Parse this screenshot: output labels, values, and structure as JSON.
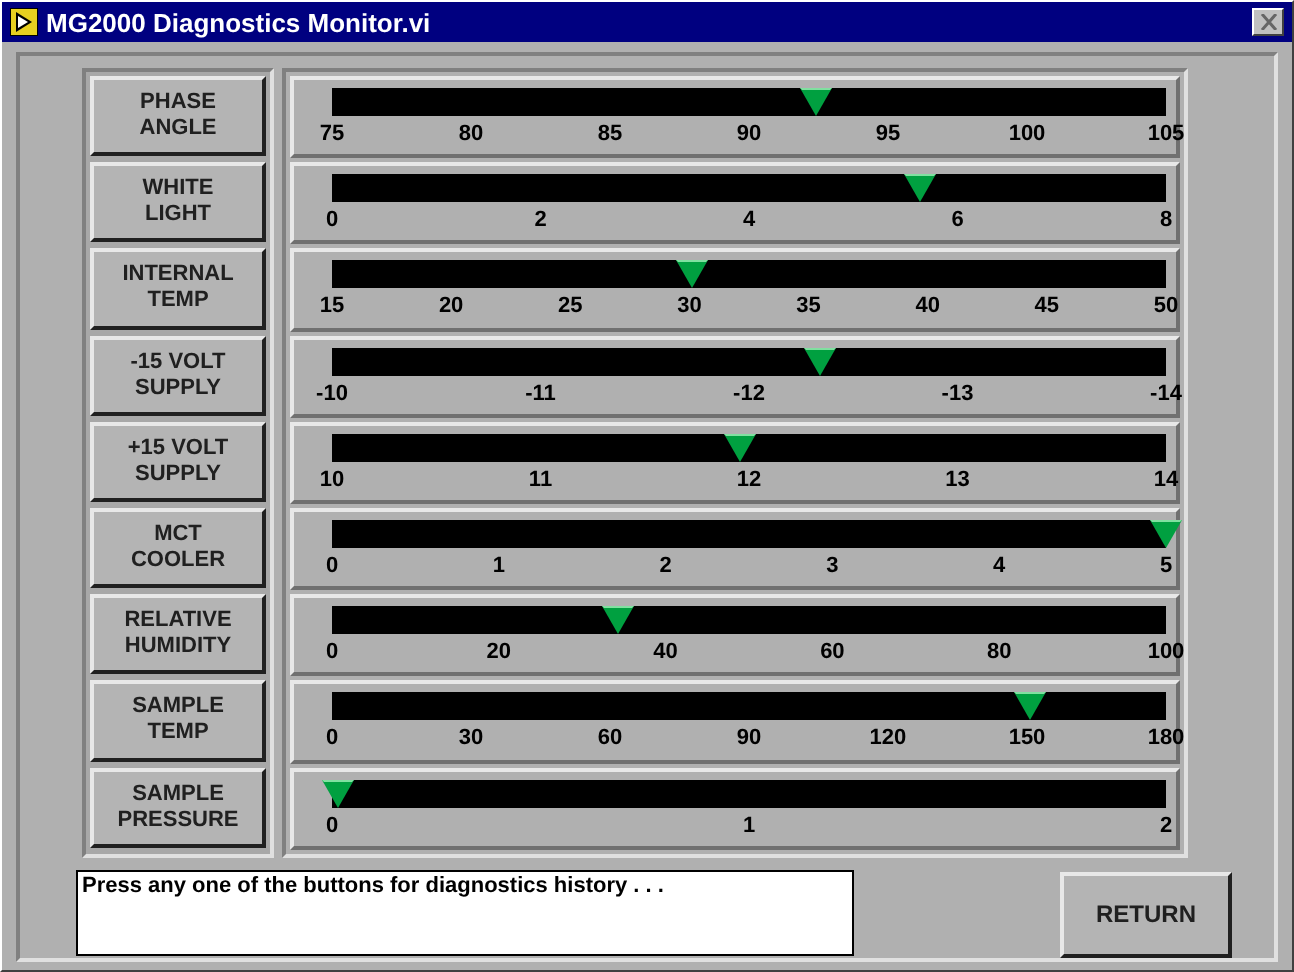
{
  "window": {
    "title": "MG2000 Diagnostics Monitor.vi"
  },
  "monitors": [
    {
      "button": "PHASE\nANGLE",
      "level": 0.581,
      "ticks": [
        "75",
        "80",
        "85",
        "90",
        "95",
        "100",
        "105"
      ]
    },
    {
      "button": "WHITE\nLIGHT",
      "level": 0.704,
      "ticks": [
        "0",
        "2",
        "4",
        "6",
        "8"
      ]
    },
    {
      "button": "INTERNAL\nTEMP",
      "level": 0.431,
      "ticks": [
        "15",
        "20",
        "25",
        "30",
        "35",
        "40",
        "45",
        "50"
      ]
    },
    {
      "button": "-15 VOLT\nSUPPLY",
      "level": 0.586,
      "ticks": [
        "-10",
        "-11",
        "-12",
        "-13",
        "-14"
      ]
    },
    {
      "button": "+15 VOLT\nSUPPLY",
      "level": 0.489,
      "ticks": [
        "10",
        "11",
        "12",
        "13",
        "14"
      ]
    },
    {
      "button": "MCT\nCOOLER",
      "level": 1.0,
      "ticks": [
        "0",
        "1",
        "2",
        "3",
        "4",
        "5"
      ]
    },
    {
      "button": "RELATIVE\nHUMIDITY",
      "level": 0.344,
      "ticks": [
        "0",
        "20",
        "40",
        "60",
        "80",
        "100"
      ]
    },
    {
      "button": "SAMPLE\nTEMP",
      "level": 0.838,
      "ticks": [
        "0",
        "30",
        "60",
        "90",
        "120",
        "150",
        "180"
      ]
    },
    {
      "button": "SAMPLE\nPRESSURE",
      "level": 0.007,
      "ticks": [
        "0",
        "1",
        "2"
      ]
    }
  ],
  "message": "Press any one of the buttons for diagnostics history . . .",
  "return_button": "RETURN"
}
